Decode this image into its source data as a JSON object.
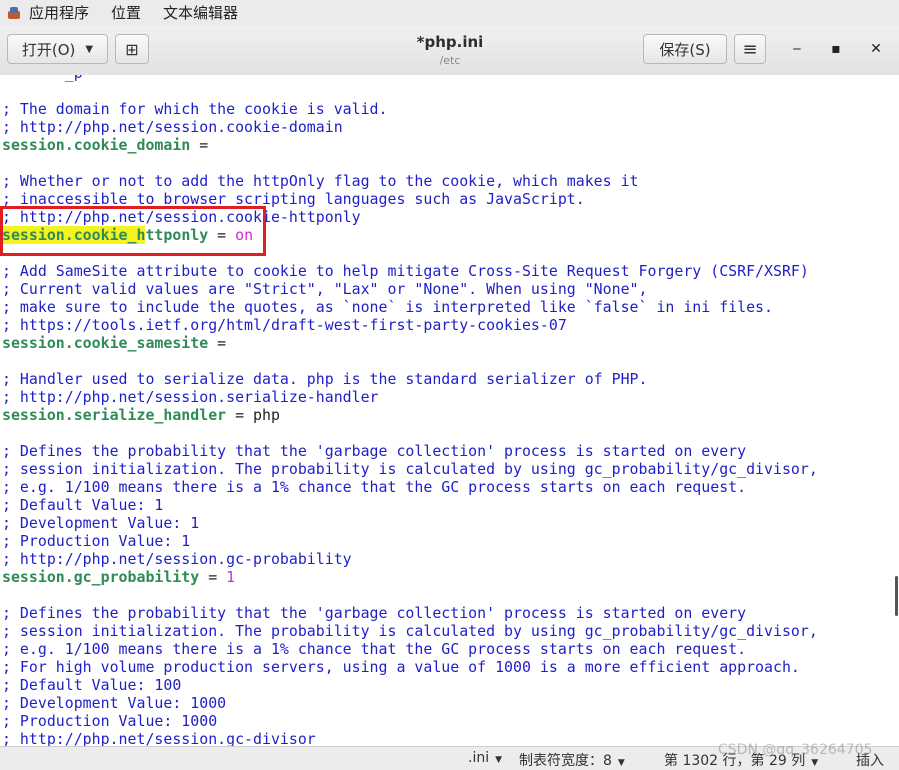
{
  "topbar": {
    "menus": [
      "应用程序",
      "位置",
      "文本编辑器"
    ]
  },
  "header": {
    "open_label": "打开(O)",
    "pin_icon": "new-document-icon",
    "title": "*php.ini",
    "subtitle": "/etc",
    "save_label": "保存(S)",
    "menu_icon": "hamburger-icon",
    "window_controls": [
      "minimize-icon",
      "maximize-icon",
      "close-icon"
    ]
  },
  "editor": {
    "lines": [
      {
        "type": "partial",
        "text": "       _p"
      },
      {
        "type": "blank",
        "text": ""
      },
      {
        "type": "comment",
        "text": "; The domain for which the cookie is valid."
      },
      {
        "type": "comment",
        "text": "; http://php.net/session.cookie-domain"
      },
      {
        "type": "setting",
        "key": "session.cookie_domain",
        "eq": " =",
        "value": "",
        "vclass": "val-plain"
      },
      {
        "type": "blank",
        "text": ""
      },
      {
        "type": "comment",
        "text": "; Whether or not to add the httpOnly flag to the cookie, which makes it"
      },
      {
        "type": "comment",
        "text": "; inaccessible to browser scripting languages such as JavaScript."
      },
      {
        "type": "comment",
        "text": "; http://php.net/session.cookie-httponly"
      },
      {
        "type": "setting-hl",
        "key_hl": "session.cookie_h",
        "key_rest": "ttponly",
        "eq": " = ",
        "value": "on",
        "vclass": "val-on"
      },
      {
        "type": "blank",
        "text": ""
      },
      {
        "type": "comment",
        "text": "; Add SameSite attribute to cookie to help mitigate Cross-Site Request Forgery (CSRF/XSRF)"
      },
      {
        "type": "comment",
        "text": "; Current valid values are \"Strict\", \"Lax\" or \"None\". When using \"None\","
      },
      {
        "type": "comment",
        "text": "; make sure to include the quotes, as `none` is interpreted like `false` in ini files."
      },
      {
        "type": "comment",
        "text": "; https://tools.ietf.org/html/draft-west-first-party-cookies-07"
      },
      {
        "type": "setting",
        "key": "session.cookie_samesite",
        "eq": " =",
        "value": "",
        "vclass": "val-plain"
      },
      {
        "type": "blank",
        "text": ""
      },
      {
        "type": "comment",
        "text": "; Handler used to serialize data. php is the standard serializer of PHP."
      },
      {
        "type": "comment",
        "text": "; http://php.net/session.serialize-handler"
      },
      {
        "type": "setting",
        "key": "session.serialize_handler",
        "eq": " = ",
        "value": "php",
        "vclass": "val-plain"
      },
      {
        "type": "blank",
        "text": ""
      },
      {
        "type": "comment",
        "text": "; Defines the probability that the 'garbage collection' process is started on every"
      },
      {
        "type": "comment",
        "text": "; session initialization. The probability is calculated by using gc_probability/gc_divisor,"
      },
      {
        "type": "comment",
        "text": "; e.g. 1/100 means there is a 1% chance that the GC process starts on each request."
      },
      {
        "type": "comment",
        "text": "; Default Value: 1"
      },
      {
        "type": "comment",
        "text": "; Development Value: 1"
      },
      {
        "type": "comment",
        "text": "; Production Value: 1"
      },
      {
        "type": "comment",
        "text": "; http://php.net/session.gc-probability"
      },
      {
        "type": "setting",
        "key": "session.gc_probability",
        "eq": " = ",
        "value": "1",
        "vclass": "val-num"
      },
      {
        "type": "blank",
        "text": ""
      },
      {
        "type": "comment",
        "text": "; Defines the probability that the 'garbage collection' process is started on every"
      },
      {
        "type": "comment",
        "text": "; session initialization. The probability is calculated by using gc_probability/gc_divisor,"
      },
      {
        "type": "comment",
        "text": "; e.g. 1/100 means there is a 1% chance that the GC process starts on each request."
      },
      {
        "type": "comment",
        "text": "; For high volume production servers, using a value of 1000 is a more efficient approach."
      },
      {
        "type": "comment",
        "text": "; Default Value: 100"
      },
      {
        "type": "comment",
        "text": "; Development Value: 1000"
      },
      {
        "type": "comment",
        "text": "; Production Value: 1000"
      },
      {
        "type": "comment",
        "text": "; http://php.net/session.gc-divisor"
      }
    ]
  },
  "statusbar": {
    "language": ".ini",
    "tab_width": "制表符宽度：8",
    "position": "第 1302 行，第 29 列",
    "mode": "插入",
    "watermark": "CSDN @qq_36264705"
  },
  "colors": {
    "comment": "#1f1fc8",
    "key": "#2e8b57",
    "value_special": "#d02bd0",
    "highlight": "#f3f320",
    "annotation_box": "#e02020"
  }
}
